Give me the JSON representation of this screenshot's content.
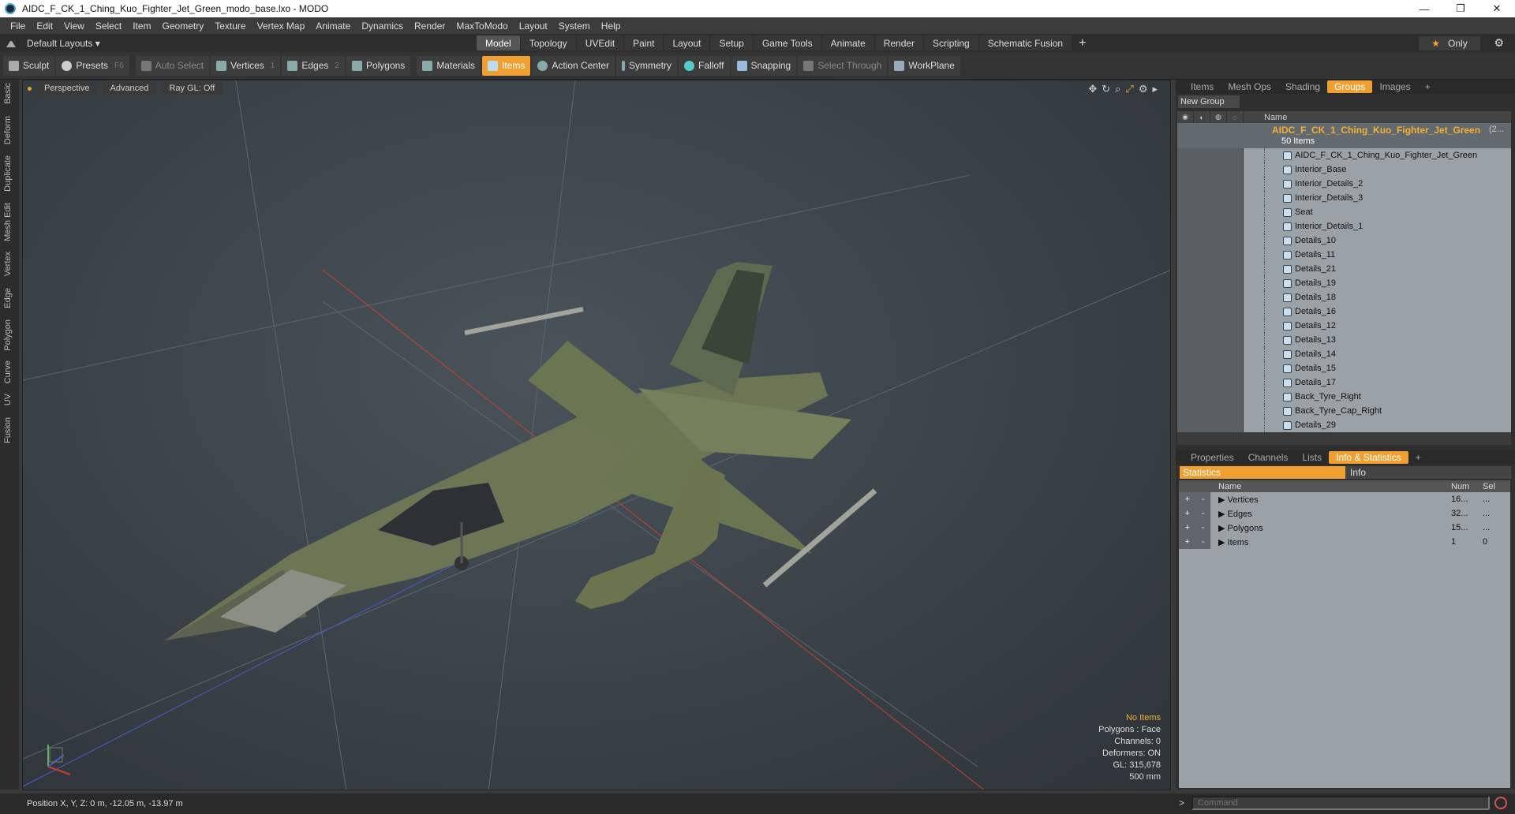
{
  "window": {
    "title": "AIDC_F_CK_1_Ching_Kuo_Fighter_Jet_Green_modo_base.lxo - MODO",
    "minimize": "—",
    "maximize": "❐",
    "close": "✕"
  },
  "menu": [
    "File",
    "Edit",
    "View",
    "Select",
    "Item",
    "Geometry",
    "Texture",
    "Vertex Map",
    "Animate",
    "Dynamics",
    "Render",
    "MaxToModo",
    "Layout",
    "System",
    "Help"
  ],
  "layout": {
    "default_layouts": "Default Layouts ▾",
    "tabs": [
      "Model",
      "Topology",
      "UVEdit",
      "Paint",
      "Layout",
      "Setup",
      "Game Tools",
      "Animate",
      "Render",
      "Scripting",
      "Schematic Fusion"
    ],
    "active_tab": "Model",
    "plus": "+",
    "only": "Only",
    "gear": "⚙"
  },
  "toolbar": {
    "sculpt": "Sculpt",
    "presets": "Presets",
    "presets_key": "F6",
    "auto_select": "Auto Select",
    "vertices": "Vertices",
    "vertices_key": "1",
    "edges": "Edges",
    "edges_key": "2",
    "polygons": "Polygons",
    "materials": "Materials",
    "items": "Items",
    "action_center": "Action Center",
    "symmetry": "Symmetry",
    "falloff": "Falloff",
    "snapping": "Snapping",
    "select_through": "Select Through",
    "workplane": "WorkPlane"
  },
  "left_tabs": [
    "Basic",
    "Deform",
    "Duplicate",
    "Mesh Edit",
    "Vertex",
    "Edge",
    "Polygon",
    "Curve",
    "UV",
    "Fusion"
  ],
  "viewport": {
    "perspective": "Perspective",
    "advanced": "Advanced",
    "raygl": "Ray GL: Off",
    "info": {
      "no_items": "No Items",
      "polygons": "Polygons : Face",
      "channels": "Channels: 0",
      "deformers": "Deformers: ON",
      "gl": "GL: 315,678",
      "scale": "500 mm"
    },
    "axis_x": "X",
    "axis_y": "Y",
    "axis_z": "Z"
  },
  "groups_panel": {
    "tabs": [
      "Items",
      "Mesh Ops",
      "Shading",
      "Groups",
      "Images"
    ],
    "active": "Groups",
    "plus": "+",
    "new_group": "New Group",
    "col_name": "Name",
    "root": "AIDC_F_CK_1_Ching_Kuo_Fighter_Jet_Green",
    "root_sub": "50 Items",
    "root_extra": "(2...",
    "items": [
      "AIDC_F_CK_1_Ching_Kuo_Fighter_Jet_Green",
      "Interior_Base",
      "Interior_Details_2",
      "Interior_Details_3",
      "Seat",
      "Interior_Details_1",
      "Details_10",
      "Details_11",
      "Details_21",
      "Details_19",
      "Details_18",
      "Details_16",
      "Details_12",
      "Details_13",
      "Details_14",
      "Details_15",
      "Details_17",
      "Back_Tyre_Right",
      "Back_Tyre_Cap_Right",
      "Details_29"
    ]
  },
  "info_panel": {
    "tabs": [
      "Properties",
      "Channels",
      "Lists",
      "Info & Statistics"
    ],
    "active": "Info & Statistics",
    "plus": "+",
    "statistics": "Statistics",
    "info": "Info",
    "col_name": "Name",
    "col_num": "Num",
    "col_sel": "Sel",
    "rows": [
      {
        "name": "Vertices",
        "num": "16...",
        "sel": "..."
      },
      {
        "name": "Edges",
        "num": "32...",
        "sel": "..."
      },
      {
        "name": "Polygons",
        "num": "15...",
        "sel": "..."
      },
      {
        "name": "Items",
        "num": "1",
        "sel": "0"
      }
    ]
  },
  "status": {
    "position": "Position X, Y, Z:   0 m, -12.05 m, -13.97 m",
    "command_placeholder": "Command",
    "prompt": ">"
  }
}
